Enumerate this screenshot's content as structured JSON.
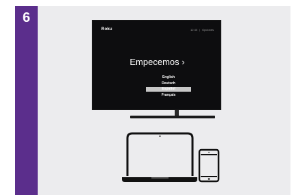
{
  "step": {
    "number": "6"
  },
  "colors": {
    "accent": "#5b2e8c",
    "panel": "#ececee",
    "screen": "#0d0d0f",
    "highlight": "#c7c7c7"
  },
  "tv": {
    "logo": "Roku",
    "time": "12:40",
    "options_label": "Opciones",
    "title": "Empecemos ›",
    "languages": [
      {
        "label": "English",
        "selected": false
      },
      {
        "label": "Deutsch",
        "selected": false
      },
      {
        "label": "Español",
        "selected": true
      },
      {
        "label": "Français",
        "selected": false
      }
    ]
  },
  "icons": {
    "laptop": "laptop-icon",
    "phone": "smartphone-icon"
  }
}
